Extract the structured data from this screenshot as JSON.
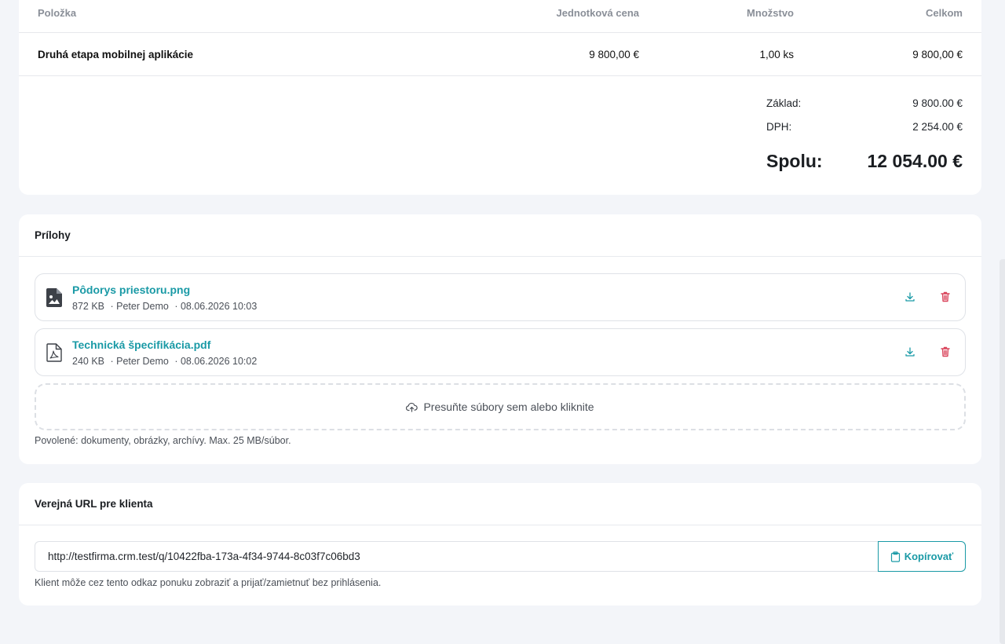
{
  "items_table": {
    "headers": {
      "item": "Položka",
      "unit_price": "Jednotková cena",
      "quantity": "Množstvo",
      "total": "Celkom"
    },
    "rows": [
      {
        "item": "Druhá etapa mobilnej aplikácie",
        "unit_price": "9 800,00 €",
        "quantity": "1,00 ks",
        "total": "9 800,00 €"
      }
    ]
  },
  "totals": {
    "base_label": "Základ:",
    "base_value": "9 800.00 €",
    "vat_label": "DPH:",
    "vat_value": "2 254.00 €",
    "grand_label": "Spolu:",
    "grand_value": "12 054.00 €"
  },
  "attachments": {
    "title": "Prílohy",
    "files": [
      {
        "name": "Pôdorys priestoru.png",
        "size": "872 KB",
        "author": "· Peter Demo",
        "date": "· 08.06.2026 10:03",
        "icon": "image-file-icon"
      },
      {
        "name": "Technická špecifikácia.pdf",
        "size": "240 KB",
        "author": "· Peter Demo",
        "date": "· 08.06.2026 10:02",
        "icon": "pdf-file-icon"
      }
    ],
    "dropzone_label": "Presuňte súbory sem alebo kliknite",
    "hint": "Povolené: dokumenty, obrázky, archívy. Max. 25 MB/súbor."
  },
  "public_url": {
    "title": "Verejná URL pre klienta",
    "value": "http://testfirma.crm.test/q/10422fba-173a-4f34-9744-8c03f7c06bd3",
    "copy_label": "Kopírovať",
    "hint": "Klient môže cez tento odkaz ponuku zobraziť a prijať/zamietnuť bez prihlásenia."
  },
  "colors": {
    "accent": "#1a9aa6",
    "danger": "#d9435a",
    "background": "#f3f5f9"
  }
}
